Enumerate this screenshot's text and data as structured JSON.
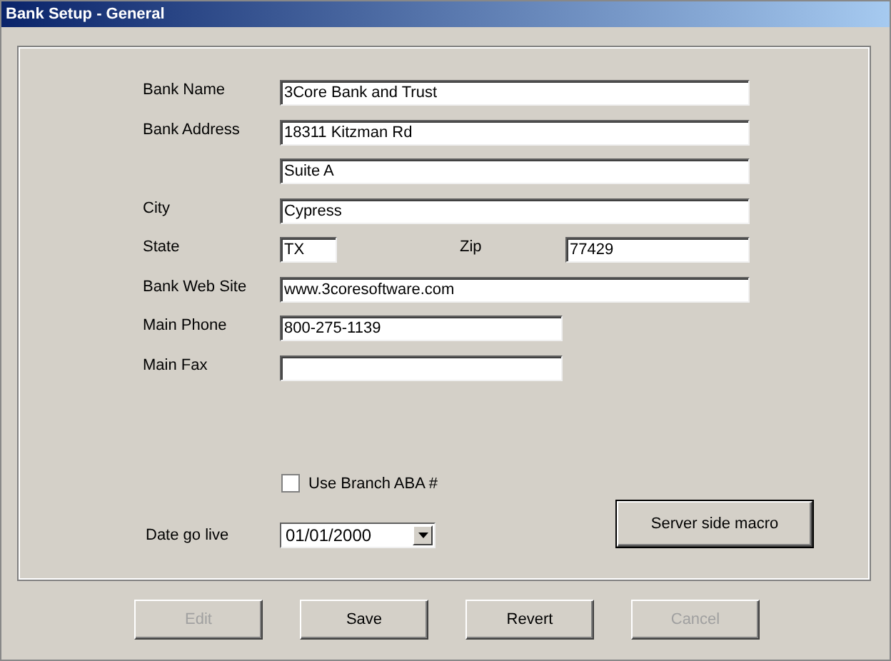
{
  "window": {
    "title": "Bank Setup - General"
  },
  "rows": [
    {
      "label": "Bank Name",
      "fields": [
        {
          "value": "3Core Bank and Trust"
        }
      ]
    },
    {
      "label": "Bank Address",
      "fields": [
        {
          "value": "18311 Kitzman Rd"
        }
      ]
    },
    {
      "fields": [
        {
          "value": "Suite A"
        }
      ]
    },
    {
      "label": "City",
      "fields": [
        {
          "value": "Cypress"
        }
      ]
    },
    {
      "label": "State",
      "fields": [
        {
          "value": "TX"
        },
        {
          "label": "Zip",
          "value": "77429"
        }
      ]
    },
    {
      "label": "Bank Web Site",
      "fields": [
        {
          "value": "www.3coresoftware.com"
        }
      ]
    },
    {
      "label": "Main Phone",
      "fields": [
        {
          "value": "800-275-1139"
        }
      ]
    },
    {
      "label": "Main Fax"
    }
  ],
  "use_branch_aba": {
    "label": "Use Branch ABA #",
    "checked": false
  },
  "date_go_live": {
    "label": "Date go live",
    "value": "01/01/2000"
  },
  "macro_button": {
    "label": "Server side macro"
  },
  "buttons": [
    {
      "label": "Edit",
      "disabled": true
    },
    {
      "label": "Save",
      "disabled": false
    },
    {
      "label": "Revert",
      "disabled": false
    },
    {
      "label": "Cancel",
      "disabled": true
    }
  ]
}
